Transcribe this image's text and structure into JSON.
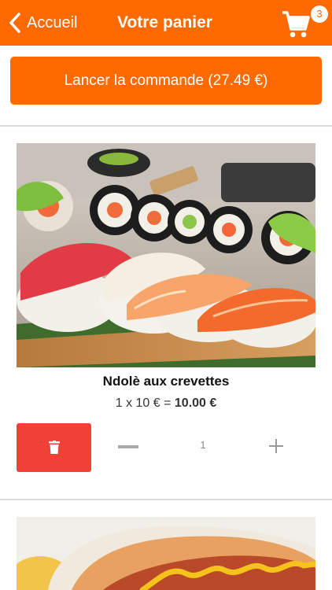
{
  "header": {
    "back_label": "Accueil",
    "title": "Votre panier",
    "cart_count": "3"
  },
  "order_button_label": "Lancer la commande (27.49 €)",
  "items": [
    {
      "name": "Ndolè aux crevettes",
      "price_prefix": "1 x 10 € = ",
      "price_total": "10.00 €",
      "quantity": "1",
      "image": "sushi-platter"
    },
    {
      "image": "hot-dog"
    }
  ],
  "colors": {
    "accent": "#ff6a00",
    "delete": "#ef4136"
  }
}
